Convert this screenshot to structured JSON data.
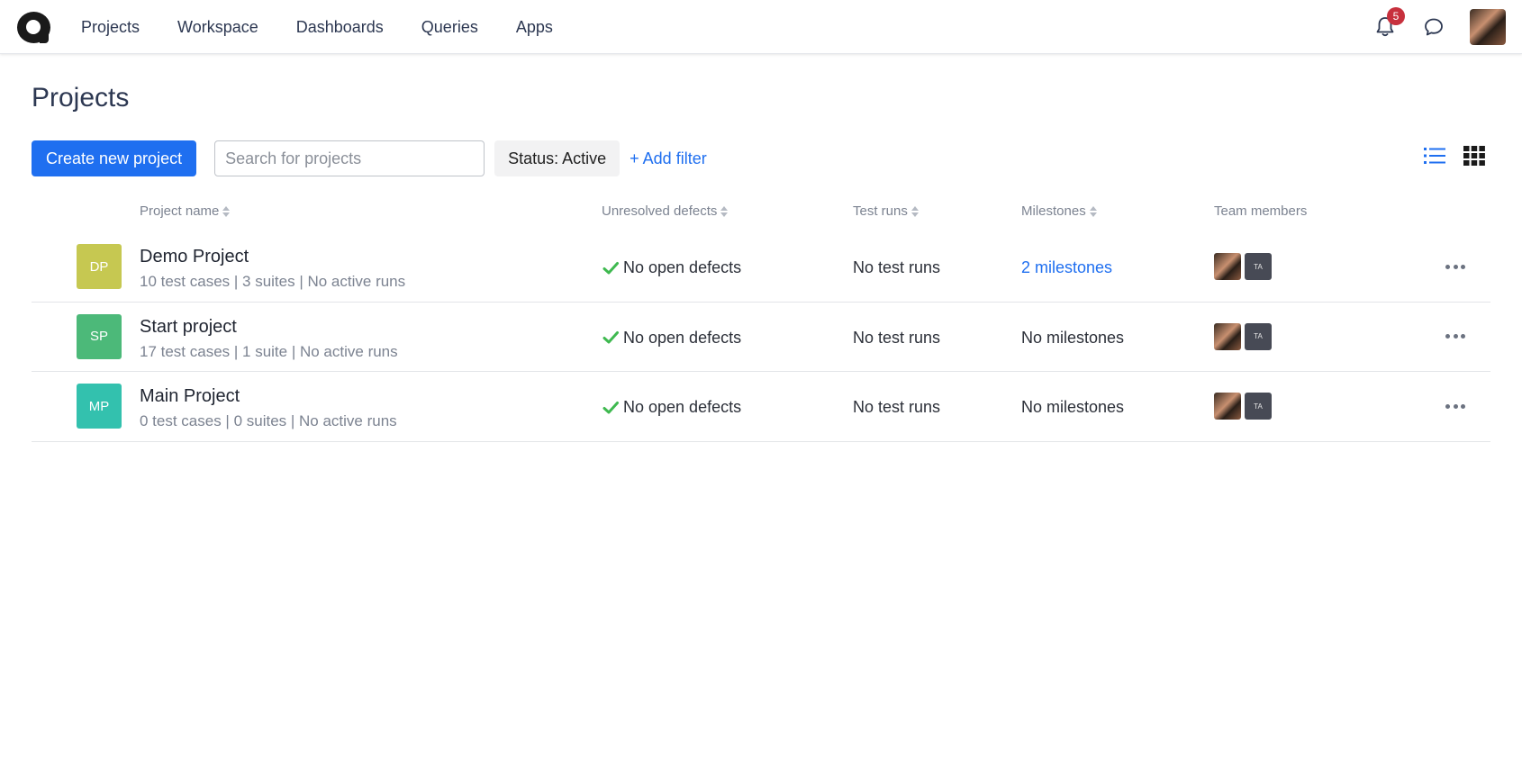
{
  "nav": {
    "items": [
      "Projects",
      "Workspace",
      "Dashboards",
      "Queries",
      "Apps"
    ],
    "notifications_count": "5"
  },
  "page": {
    "title": "Projects"
  },
  "toolbar": {
    "create_label": "Create new project",
    "search_placeholder": "Search for projects",
    "status_filter": "Status: Active",
    "add_filter": "+ Add filter"
  },
  "table": {
    "headers": {
      "name": "Project name",
      "defects": "Unresolved defects",
      "runs": "Test runs",
      "milestones": "Milestones",
      "members": "Team members"
    },
    "rows": [
      {
        "initials": "DP",
        "color": "#c6c851",
        "name": "Demo Project",
        "meta": "10 test cases | 3 suites | No active runs",
        "defects": "No open defects",
        "runs": "No test runs",
        "milestones": "2 milestones",
        "milestones_link": true,
        "member_badge": "TA"
      },
      {
        "initials": "SP",
        "color": "#4cb979",
        "name": "Start project",
        "meta": "17 test cases | 1 suite | No active runs",
        "defects": "No open defects",
        "runs": "No test runs",
        "milestones": "No milestones",
        "milestones_link": false,
        "member_badge": "TA"
      },
      {
        "initials": "MP",
        "color": "#33c1ae",
        "name": "Main Project",
        "meta": "0 test cases | 0 suites | No active runs",
        "defects": "No open defects",
        "runs": "No test runs",
        "milestones": "No milestones",
        "milestones_link": false,
        "member_badge": "TA"
      }
    ]
  },
  "colors": {
    "primary": "#1f6ff0",
    "success": "#3fb950",
    "badge": "#c7303d"
  },
  "icons": [
    "logo-icon",
    "bell-icon",
    "chat-icon",
    "list-view-icon",
    "grid-view-icon",
    "check-icon",
    "more-icon",
    "sort-icon"
  ]
}
